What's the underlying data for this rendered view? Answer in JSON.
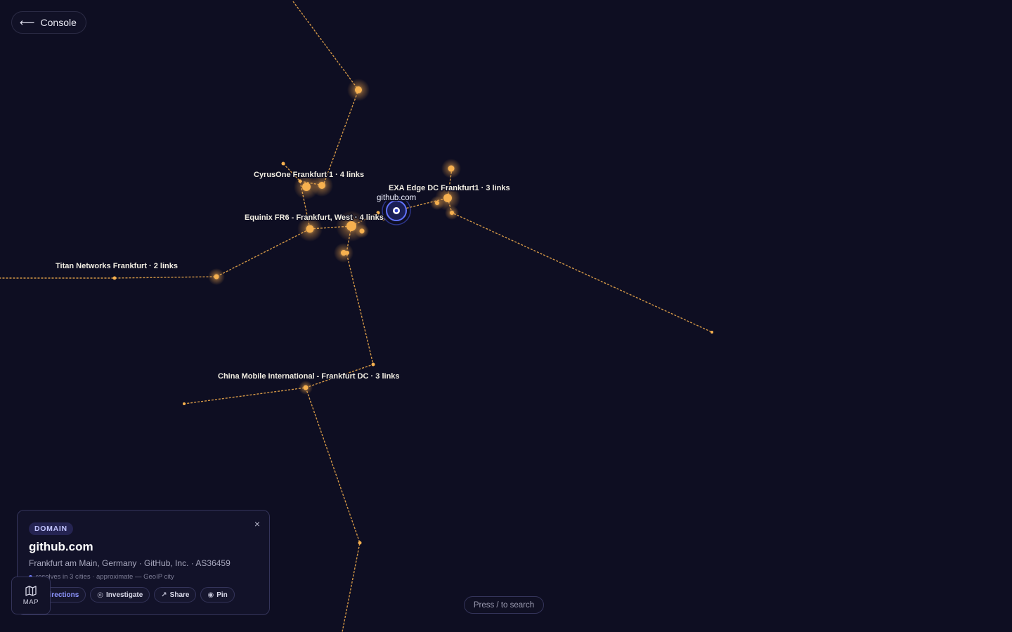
{
  "nav": {
    "back_label": "Console",
    "back_icon": "arrow-left-icon"
  },
  "map": {
    "line_color": "#e9a64a",
    "node_color": "#f6b04f",
    "target_color": "#5b6cff",
    "target": {
      "label": "github.com"
    },
    "facilities": [
      {
        "id": "cyrusone",
        "label": "CyrusOne Frankfurt 1 · 4 links"
      },
      {
        "id": "exa",
        "label": "EXA Edge DC Frankfurt1 · 3 links"
      },
      {
        "id": "equinix",
        "label": "Equinix FR6 - Frankfurt, West · 4 links"
      },
      {
        "id": "titan",
        "label": "Titan Networks Frankfurt · 2 links"
      },
      {
        "id": "chinamobile",
        "label": "China Mobile International - Frankfurt DC · 3 links"
      }
    ]
  },
  "card": {
    "badge": "DOMAIN",
    "close_label": "×",
    "title": "github.com",
    "subtitle": "Frankfurt am Main, Germany · GitHub, Inc. · AS36459",
    "note": "resolves in 3 cities · approximate — GeoIP city",
    "actions": [
      {
        "label": "Directions",
        "icon": "directions-icon"
      },
      {
        "label": "Investigate",
        "icon": "investigate-icon"
      },
      {
        "label": "Share",
        "icon": "share-icon"
      },
      {
        "label": "Pin",
        "icon": "pin-icon"
      }
    ]
  },
  "map_toggle": {
    "label": "MAP",
    "icon": "map-icon"
  },
  "search_hint": "Press / to search"
}
